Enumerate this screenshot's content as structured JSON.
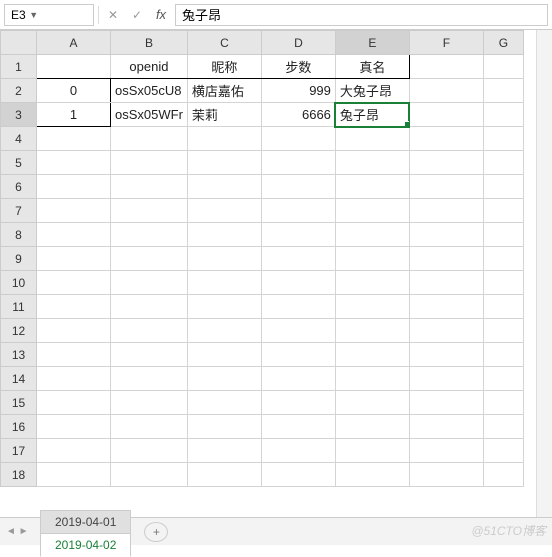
{
  "namebox": {
    "cell_ref": "E3"
  },
  "formula_bar": {
    "value": "兔子昂"
  },
  "columns": [
    "A",
    "B",
    "C",
    "D",
    "E",
    "F",
    "G"
  ],
  "selected": {
    "col": "E",
    "row": 3
  },
  "headers": {
    "B": "openid",
    "C": "昵称",
    "D": "步数",
    "E": "真名"
  },
  "data_rows": [
    {
      "idx": "0",
      "openid": "osSx05cU8",
      "nick": "横店嘉佑",
      "steps": "999",
      "real": "大兔子昂"
    },
    {
      "idx": "1",
      "openid": "osSx05WFr",
      "nick": "茉莉",
      "steps": "6666",
      "real": "兔子昂"
    }
  ],
  "row_count": 18,
  "tabs": [
    "2019-04-01",
    "2019-04-02"
  ],
  "active_tab": 1,
  "watermark": "@51CTO博客"
}
